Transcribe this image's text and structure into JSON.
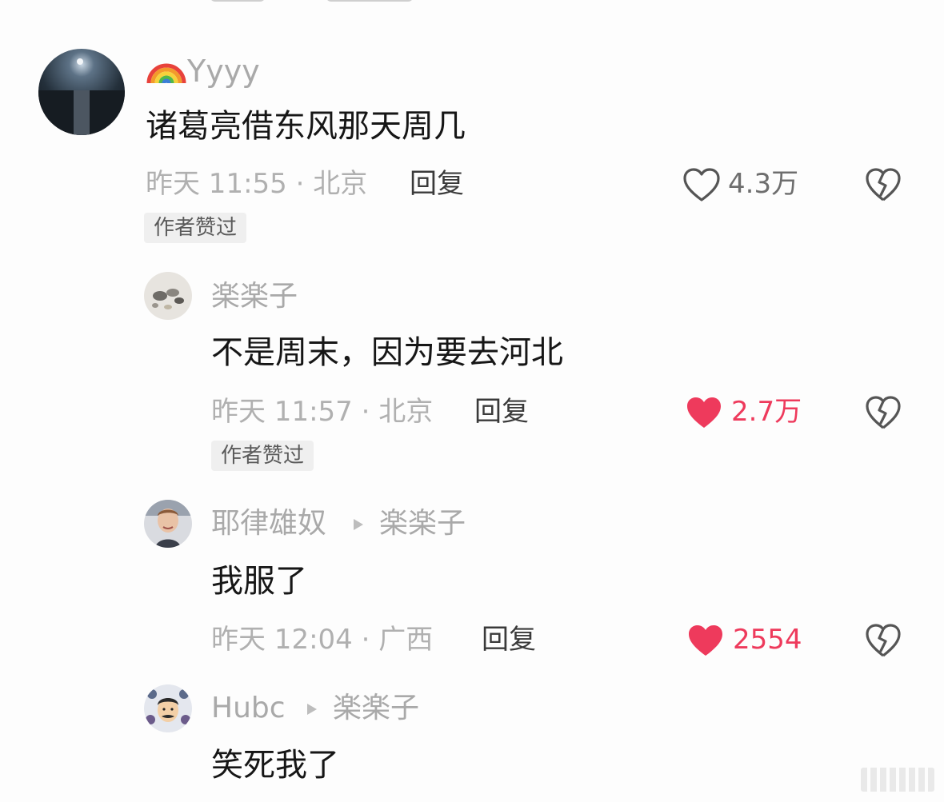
{
  "comments": [
    {
      "username": "Yyyy",
      "username_prefix_icon": "rainbow-emoji",
      "text": "诸葛亮借东风那天周几",
      "meta": "昨天 11:55 · 北京",
      "reply_label": "回复",
      "like_count": "4.3万",
      "liked": false,
      "badge": "作者赞过"
    },
    {
      "username": "楽楽子",
      "text": "不是周末，因为要去河北",
      "meta": "昨天 11:57 · 北京",
      "reply_label": "回复",
      "like_count": "2.7万",
      "liked": true,
      "badge": "作者赞过"
    },
    {
      "username": "耶律雄奴",
      "reply_to": "楽楽子",
      "text": "我服了",
      "meta": "昨天 12:04 · 广西",
      "reply_label": "回复",
      "like_count": "2554",
      "liked": true
    },
    {
      "username": "Hubc",
      "reply_to": "楽楽子",
      "text": "笑死我了"
    }
  ],
  "colors": {
    "liked": "#ee3a5c",
    "muted": "#a9a9a9",
    "text": "#161616"
  }
}
